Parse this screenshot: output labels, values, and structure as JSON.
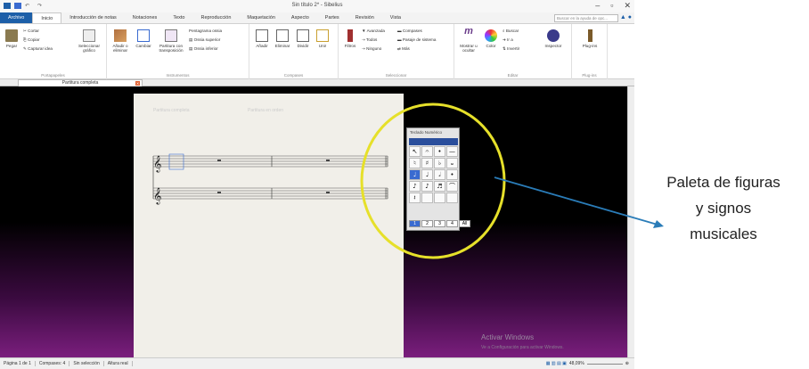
{
  "window": {
    "title": "Sin título 2* - Sibelius",
    "controls": [
      "–",
      "▫",
      "✕"
    ]
  },
  "ribbon_tabs": [
    "Archivo",
    "Inicio",
    "Introducción de notas",
    "Notaciones",
    "Texto",
    "Reproducción",
    "Maquetación",
    "Aspecto",
    "Partes",
    "Revisión",
    "Vista"
  ],
  "search_placeholder": "Buscar en la ayuda de opc...",
  "groups": {
    "portapapeles": {
      "name": "Portapapeles",
      "pegar": "Pegar",
      "cortar": "Cortar",
      "copiar": "Copiar",
      "capturar": "Capturar idea",
      "seleccionar": "Seleccionar gráfico"
    },
    "instrumentos": {
      "name": "Instrumentos",
      "anadir": "Añadir o eliminar",
      "cambiar": "Cambiar",
      "partitura": "Partitura con transposición",
      "pentagrama": "Pentagrama ossia",
      "ossia_sup": "Ossia superior",
      "ossia_inf": "Ossia inferior"
    },
    "compases": {
      "name": "Compases",
      "anadir": "Añadir",
      "eliminar": "Eliminar",
      "dividir": "Dividir",
      "unir": "Unir"
    },
    "seleccionar": {
      "name": "Seleccionar",
      "filtros": "Filtros",
      "avanzada": "Avanzada",
      "compases": "Compases",
      "todos": "Todos",
      "pasaje": "Pasaje de sistema",
      "ninguno": "Ninguno",
      "mas": "Más"
    },
    "editar": {
      "name": "Editar",
      "mostrar": "Mostrar u ocultar",
      "color": "Color",
      "buscar": "Buscar",
      "ir": "Ir a",
      "invertir": "Invertir",
      "inspector": "Inspector"
    },
    "plugins": {
      "name": "Plug-ins",
      "label": "Plug-ins"
    }
  },
  "document_tab": "Partitura completa",
  "page": {
    "placeholder_title": "Partitura completa",
    "placeholder_instr": "Partitura en orden"
  },
  "palette": {
    "title": "Teclado Numérico",
    "cells": [
      "↖",
      "𝄐",
      "•",
      "—",
      "♮",
      "♯",
      "♭",
      "𝄪",
      "♩",
      "♩",
      "𝅗𝅥",
      "•",
      "♪",
      "♪",
      "♬",
      "⌒",
      "𝄽",
      "",
      "",
      ""
    ],
    "tabs": [
      "1",
      "2",
      "3",
      "4",
      "All"
    ]
  },
  "watermark": {
    "line1": "Activar Windows",
    "line2": "Ve a Configuración para activar Windows."
  },
  "status": {
    "page": "Página 1 de 1",
    "bars": "Compases: 4",
    "selection": "Sin selección",
    "pitch": "Altura real",
    "zoom": "48,09%"
  },
  "annotation": {
    "line1": "Paleta de figuras",
    "line2": "y signos",
    "line3": "musicales"
  },
  "colors": {
    "accent": "#1d5fa8",
    "highlight_circle": "#e6e02a",
    "arrow": "#2a7cb8"
  }
}
